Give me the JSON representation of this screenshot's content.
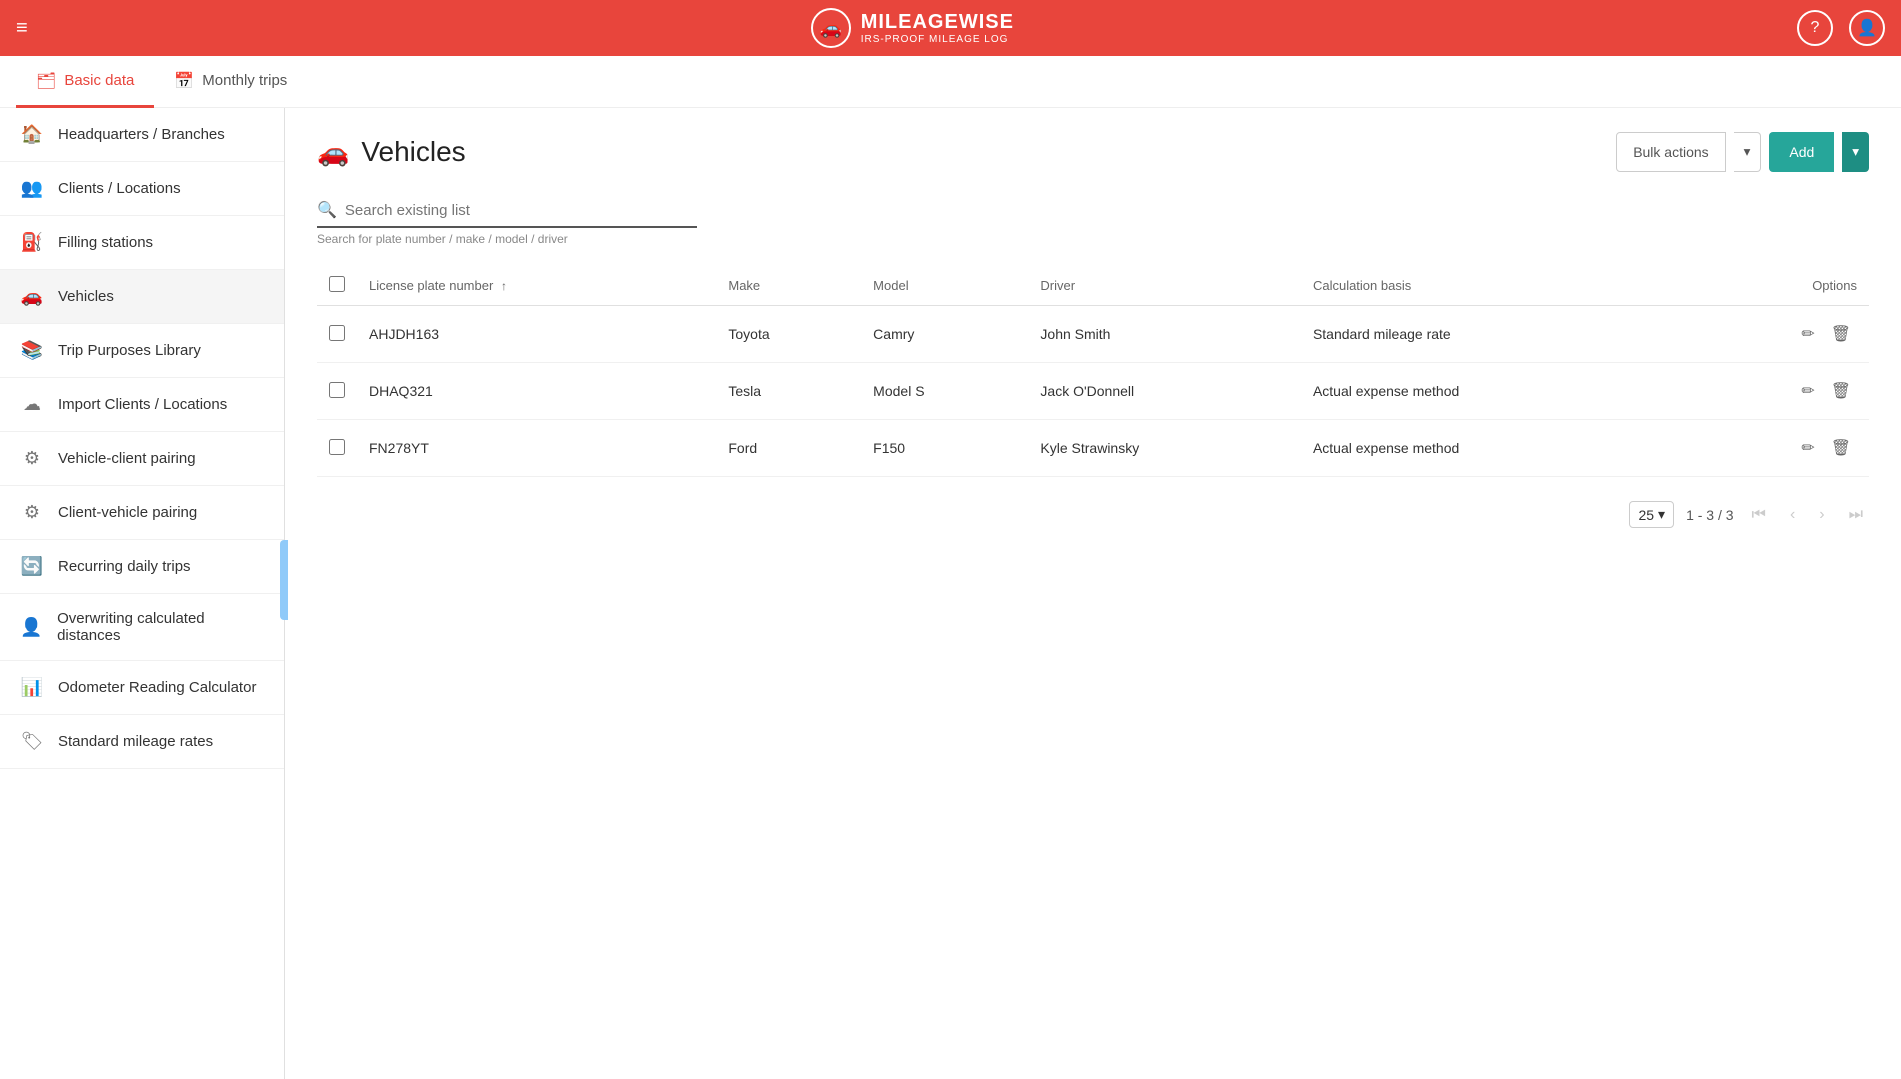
{
  "brand": {
    "name": "MILEAGEWISE",
    "sub": "IRS-PROOF MILEAGE LOG"
  },
  "topnav": {
    "hamburger": "≡"
  },
  "subnav": {
    "tabs": [
      {
        "id": "basic-data",
        "label": "Basic data",
        "icon": "🗂",
        "active": true
      },
      {
        "id": "monthly-trips",
        "label": "Monthly trips",
        "icon": "📅",
        "active": false
      }
    ]
  },
  "sidebar": {
    "items": [
      {
        "id": "headquarters",
        "label": "Headquarters / Branches",
        "icon": "🏠"
      },
      {
        "id": "clients",
        "label": "Clients / Locations",
        "icon": "👥"
      },
      {
        "id": "filling-stations",
        "label": "Filling stations",
        "icon": "⛽"
      },
      {
        "id": "vehicles",
        "label": "Vehicles",
        "icon": "🚗",
        "active": true
      },
      {
        "id": "trip-purposes",
        "label": "Trip Purposes Library",
        "icon": "📚"
      },
      {
        "id": "import-clients",
        "label": "Import Clients / Locations",
        "icon": "☁"
      },
      {
        "id": "vehicle-client",
        "label": "Vehicle-client pairing",
        "icon": "⚙"
      },
      {
        "id": "client-vehicle",
        "label": "Client-vehicle pairing",
        "icon": "⚙"
      },
      {
        "id": "recurring-trips",
        "label": "Recurring daily trips",
        "icon": "🔄"
      },
      {
        "id": "overwriting",
        "label": "Overwriting calculated distances",
        "icon": "👤"
      },
      {
        "id": "odometer",
        "label": "Odometer Reading Calculator",
        "icon": "📊"
      },
      {
        "id": "standard-rates",
        "label": "Standard mileage rates",
        "icon": "🏷"
      }
    ]
  },
  "page": {
    "title": "Vehicles",
    "icon": "🚗"
  },
  "actions": {
    "bulk_label": "Bulk actions",
    "add_label": "Add"
  },
  "search": {
    "placeholder": "Search existing list",
    "hint": "Search for plate number / make / model / driver"
  },
  "table": {
    "columns": [
      {
        "id": "plate",
        "label": "License plate number",
        "sortable": true
      },
      {
        "id": "make",
        "label": "Make"
      },
      {
        "id": "model",
        "label": "Model"
      },
      {
        "id": "driver",
        "label": "Driver"
      },
      {
        "id": "basis",
        "label": "Calculation basis"
      },
      {
        "id": "options",
        "label": "Options"
      }
    ],
    "rows": [
      {
        "plate": "AHJDH163",
        "make": "Toyota",
        "model": "Camry",
        "driver": "John Smith",
        "basis": "Standard mileage rate"
      },
      {
        "plate": "DHAQ321",
        "make": "Tesla",
        "model": "Model S",
        "driver": "Jack O'Donnell",
        "basis": "Actual expense method"
      },
      {
        "plate": "FN278YT",
        "make": "Ford",
        "model": "F150",
        "driver": "Kyle Strawinsky",
        "basis": "Actual expense method"
      }
    ]
  },
  "pagination": {
    "per_page": "25",
    "page_info": "1 - 3 / 3"
  }
}
